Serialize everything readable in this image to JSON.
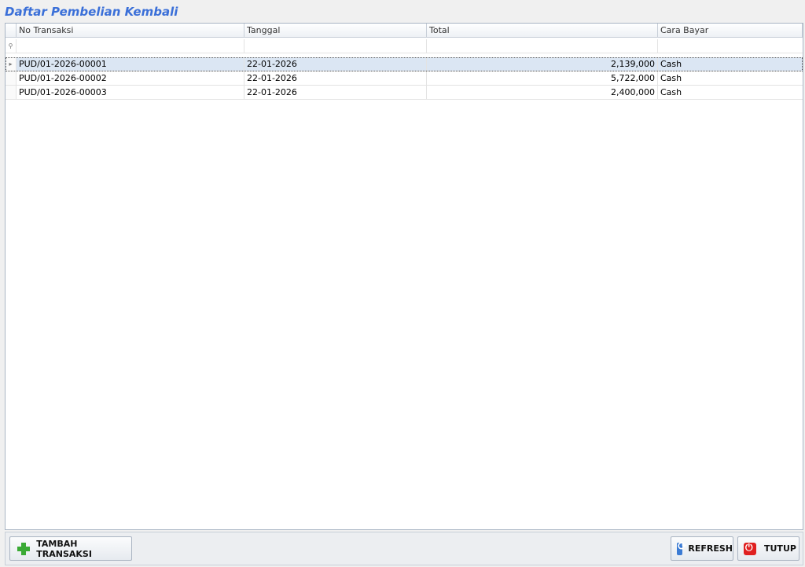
{
  "window": {
    "title": "Daftar Pembelian Kembali"
  },
  "grid": {
    "columns": [
      "No Transaksi",
      "Tanggal",
      "Total",
      "Cara Bayar"
    ],
    "filter_icon": "filter-icon",
    "rows": [
      {
        "no": "PUD/01-2026-00001",
        "tanggal": "22-01-2026",
        "total": "2,139,000",
        "cara_bayar": "Cash",
        "selected": true
      },
      {
        "no": "PUD/01-2026-00002",
        "tanggal": "22-01-2026",
        "total": "5,722,000",
        "cara_bayar": "Cash"
      },
      {
        "no": "PUD/01-2026-00003",
        "tanggal": "22-01-2026",
        "total": "2,400,000",
        "cara_bayar": "Cash"
      }
    ]
  },
  "buttons": {
    "add": {
      "label": "TAMBAH TRANSAKSI",
      "icon": "plus-icon",
      "color": "#3aaa35"
    },
    "refresh": {
      "label": "REFRESH",
      "icon": "refresh-icon",
      "color": "#3b7bd4"
    },
    "close": {
      "label": "TUTUP",
      "icon": "power-icon",
      "color": "#e02020"
    }
  },
  "colors": {
    "title": "#3a6fd8",
    "selected_row": "#dbe6f3"
  }
}
